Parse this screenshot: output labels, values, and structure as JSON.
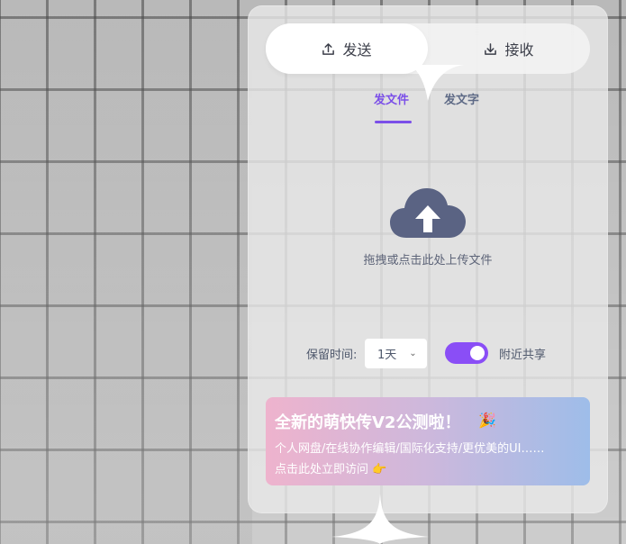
{
  "mode_switch": {
    "send_label": "发送",
    "receive_label": "接收",
    "active": "send"
  },
  "sub_tabs": {
    "file_label": "发文件",
    "text_label": "发文字",
    "active": "file"
  },
  "upload": {
    "hint": "拖拽或点击此处上传文件",
    "icon": "cloud-upload-icon"
  },
  "settings": {
    "retention_label": "保留时间:",
    "retention_value": "1天",
    "nearby_label": "附近共享",
    "nearby_enabled": true
  },
  "banner": {
    "title": "全新的萌快传V2公测啦！",
    "emoji": "🎉",
    "description": "个人网盘/在线协作编辑/国际化支持/更优美的UI……",
    "link_text": "点击此处立即访问 👉"
  },
  "colors": {
    "accent": "#8a4ef6",
    "tab_active": "#7b4fe8",
    "upload_icon": "#5a6383"
  }
}
